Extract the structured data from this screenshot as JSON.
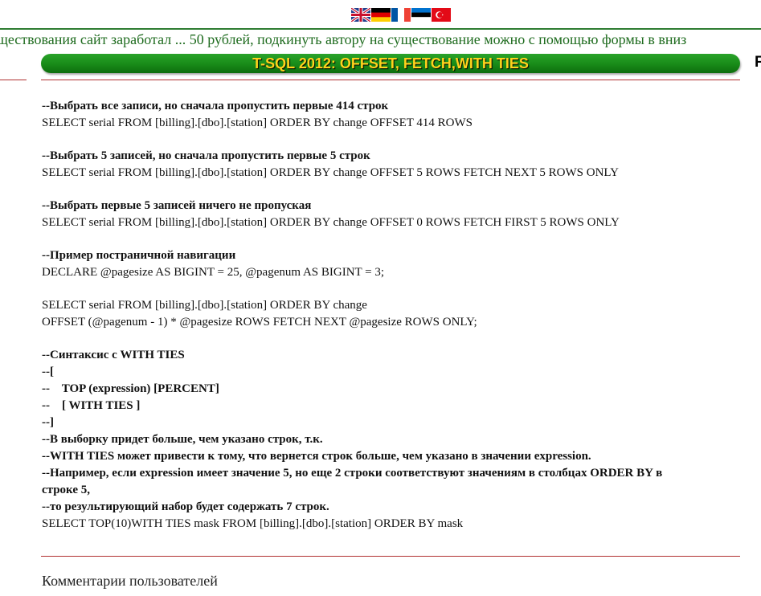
{
  "languages": [
    {
      "code": "en",
      "icon": "flag-uk-icon"
    },
    {
      "code": "de",
      "icon": "flag-germany-icon"
    },
    {
      "code": "fr",
      "icon": "flag-france-icon"
    },
    {
      "code": "et",
      "icon": "flag-estonia-icon"
    },
    {
      "code": "tr",
      "icon": "flag-turkey-icon"
    }
  ],
  "marquee": "ществования сайт заработал ... 50 рублей, подкинуть автору на существование можно с помощью формы в вниз",
  "right_letter": "F",
  "title": "T-SQL 2012: OFFSET, FETCH,WITH TIES",
  "content": {
    "block1": {
      "comment": "--Выбрать все записи, но сначала пропустить первые 414 строк",
      "code": "SELECT serial FROM [billing].[dbo].[station] ORDER BY change OFFSET 414 ROWS"
    },
    "block2": {
      "comment": "--Выбрать 5 записей, но сначала пропустить первые 5 строк",
      "code": "SELECT serial FROM [billing].[dbo].[station] ORDER BY change OFFSET 5 ROWS FETCH NEXT 5 ROWS ONLY"
    },
    "block3": {
      "comment": "--Выбрать первые 5 записей ничего не пропуская",
      "code": "SELECT serial FROM [billing].[dbo].[station] ORDER BY change OFFSET 0 ROWS FETCH FIRST 5 ROWS ONLY"
    },
    "block4": {
      "comment": "--Пример постраничной навигации",
      "code1": "DECLARE @pagesize AS BIGINT = 25, @pagenum AS BIGINT = 3;",
      "code2": "SELECT serial FROM [billing].[dbo].[station] ORDER BY change",
      "code3": "OFFSET (@pagenum - 1) * @pagesize ROWS FETCH NEXT @pagesize ROWS ONLY;"
    },
    "block5": {
      "l1": "--Синтаксис с WITH TIES",
      "l2": "--[",
      "l3": "--    TOP (expression) [PERCENT]",
      "l4": "--    [ WITH TIES ]",
      "l5": "--]",
      "l6": "--В выборку придет больше, чем указано строк, т.к.",
      "l7": "--WITH TIES может привести к тому, что вернется строк больше, чем указано в значении expression.",
      "l8": "--Например, если expression имеет значение 5, но еще 2 строки соответствуют значениям в столбцах ORDER BY в",
      "l9": "строке 5,",
      "l10": "--то результирующий набор будет содержать 7 строк.",
      "code": "SELECT TOP(10)WITH TIES mask FROM [billing].[dbo].[station] ORDER BY mask"
    }
  },
  "comments_heading": "Комментарии пользователей"
}
